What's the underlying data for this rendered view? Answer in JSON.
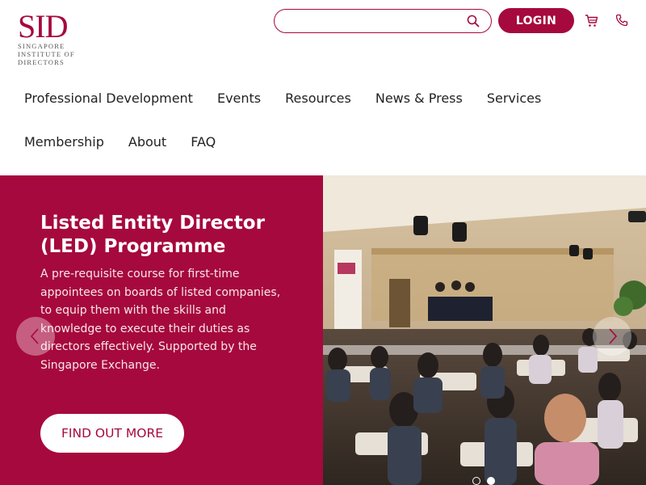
{
  "brand": {
    "logo_text": "SID",
    "logo_lines": [
      "SINGAPORE",
      "INSTITUTE OF",
      "DIRECTORS"
    ],
    "accent_color": "#a6093d"
  },
  "header": {
    "search_placeholder": "",
    "search_value": "",
    "login_label": "LOGIN",
    "icons": [
      "search-icon",
      "cart-icon",
      "phone-icon"
    ]
  },
  "nav": {
    "items": [
      {
        "label": "Professional Development"
      },
      {
        "label": "Events"
      },
      {
        "label": "Resources"
      },
      {
        "label": "News & Press"
      },
      {
        "label": "Services"
      },
      {
        "label": "Membership"
      },
      {
        "label": "About"
      },
      {
        "label": "FAQ"
      }
    ]
  },
  "hero": {
    "title": "Listed Entity Director (LED) Programme",
    "description": "A pre-requisite course for first-time appointees on boards of listed companies, to equip them with the skills and knowledge to execute their duties as directors effectively. Supported by the Singapore Exchange.",
    "cta_label": "FIND OUT MORE",
    "slide_count": 2,
    "active_slide": 2
  }
}
